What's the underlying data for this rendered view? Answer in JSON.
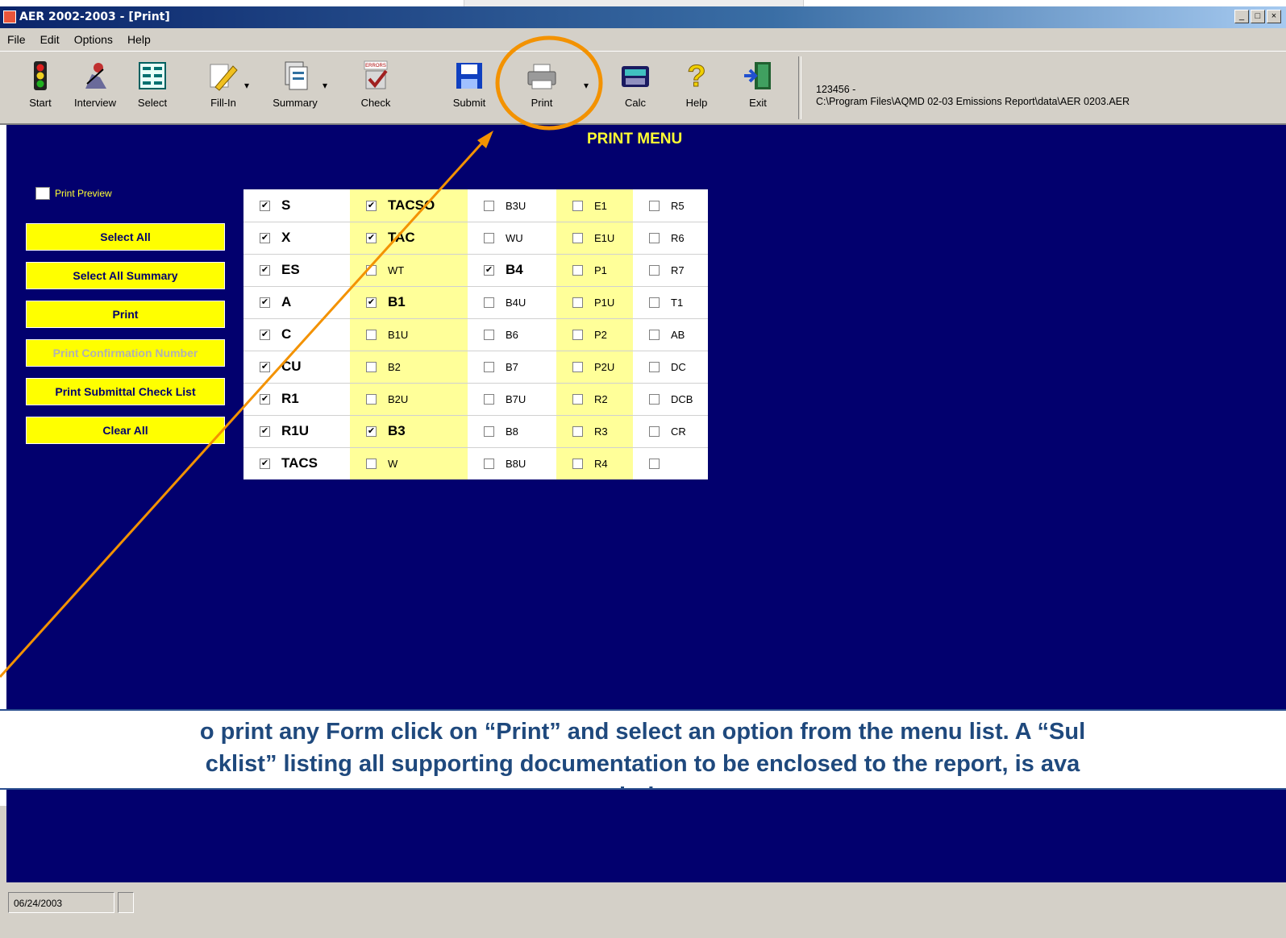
{
  "window": {
    "title": "AER 2002-2003 - [Print]",
    "controls": [
      "_",
      "□",
      "×"
    ]
  },
  "menu": [
    "File",
    "Edit",
    "Options",
    "Help"
  ],
  "toolbar": {
    "buttons": [
      {
        "label": "Start",
        "icon": "traffic-light-icon"
      },
      {
        "label": "Interview",
        "icon": "interview-icon"
      },
      {
        "label": "Select",
        "icon": "select-icon"
      },
      {
        "label": "Fill-In",
        "icon": "pencil-icon"
      },
      {
        "label": "Summary",
        "icon": "summary-icon"
      },
      {
        "label": "Check",
        "icon": "check-icon"
      },
      {
        "label": "Submit",
        "icon": "floppy-disk-icon"
      },
      {
        "label": "Print",
        "icon": "printer-icon"
      },
      {
        "label": "Calc",
        "icon": "calculator-icon"
      },
      {
        "label": "Help",
        "icon": "question-mark-icon"
      },
      {
        "label": "Exit",
        "icon": "exit-door-icon"
      }
    ],
    "file_id": "123456 -",
    "file_path": "C:\\Program Files\\AQMD 02-03 Emissions Report\\data\\AER 0203.AER"
  },
  "content": {
    "heading": "PRINT MENU",
    "print_preview": "Print Preview",
    "buttons": {
      "select_all": "Select All",
      "select_all_summary": "Select All Summary",
      "print": "Print",
      "print_confirmation": "Print Confirmation Number",
      "print_checklist": "Print Submittal Check List",
      "clear_all": "Clear All"
    },
    "grid": {
      "col1": [
        {
          "label": "S",
          "checked": true
        },
        {
          "label": "X",
          "checked": true
        },
        {
          "label": "ES",
          "checked": true
        },
        {
          "label": "A",
          "checked": true
        },
        {
          "label": "C",
          "checked": true
        },
        {
          "label": "CU",
          "checked": true
        },
        {
          "label": "R1",
          "checked": true
        },
        {
          "label": "R1U",
          "checked": true
        },
        {
          "label": "TACS",
          "checked": true
        }
      ],
      "col2": [
        {
          "label": "TACSO",
          "checked": true
        },
        {
          "label": "TAC",
          "checked": true
        },
        {
          "label": "WT",
          "checked": false
        },
        {
          "label": "B1",
          "checked": true
        },
        {
          "label": "B1U",
          "checked": false
        },
        {
          "label": "B2",
          "checked": false
        },
        {
          "label": "B2U",
          "checked": false
        },
        {
          "label": "B3",
          "checked": true
        },
        {
          "label": "W",
          "checked": false
        }
      ],
      "col3": [
        {
          "label": "B3U",
          "checked": false
        },
        {
          "label": "WU",
          "checked": false
        },
        {
          "label": "B4",
          "checked": true
        },
        {
          "label": "B4U",
          "checked": false
        },
        {
          "label": "B6",
          "checked": false
        },
        {
          "label": "B7",
          "checked": false
        },
        {
          "label": "B7U",
          "checked": false
        },
        {
          "label": "B8",
          "checked": false
        },
        {
          "label": "B8U",
          "checked": false
        }
      ],
      "col4": [
        {
          "label": "E1",
          "checked": false
        },
        {
          "label": "E1U",
          "checked": false
        },
        {
          "label": "P1",
          "checked": false
        },
        {
          "label": "P1U",
          "checked": false
        },
        {
          "label": "P2",
          "checked": false
        },
        {
          "label": "P2U",
          "checked": false
        },
        {
          "label": "R2",
          "checked": false
        },
        {
          "label": "R3",
          "checked": false
        },
        {
          "label": "R4",
          "checked": false
        }
      ],
      "col5": [
        {
          "label": "R5",
          "checked": false
        },
        {
          "label": "R6",
          "checked": false
        },
        {
          "label": "R7",
          "checked": false
        },
        {
          "label": "T1",
          "checked": false
        },
        {
          "label": "AB",
          "checked": false
        },
        {
          "label": "DC",
          "checked": false
        },
        {
          "label": "DCB",
          "checked": false
        },
        {
          "label": "CR",
          "checked": false
        },
        {
          "label": "",
          "checked": false
        }
      ]
    }
  },
  "annotation": {
    "line1": "o print any Form click on “Print” and select an option from the menu list. A “Sul",
    "line2": "cklist” listing all supporting documentation to be enclosed to the report, is ava",
    "line3": "printing."
  },
  "status": {
    "date": "06/24/2003"
  },
  "colors": {
    "background": "#02006e",
    "button": "#ffff00",
    "highlight": "#f39200",
    "annotation_text": "#1f497d"
  }
}
